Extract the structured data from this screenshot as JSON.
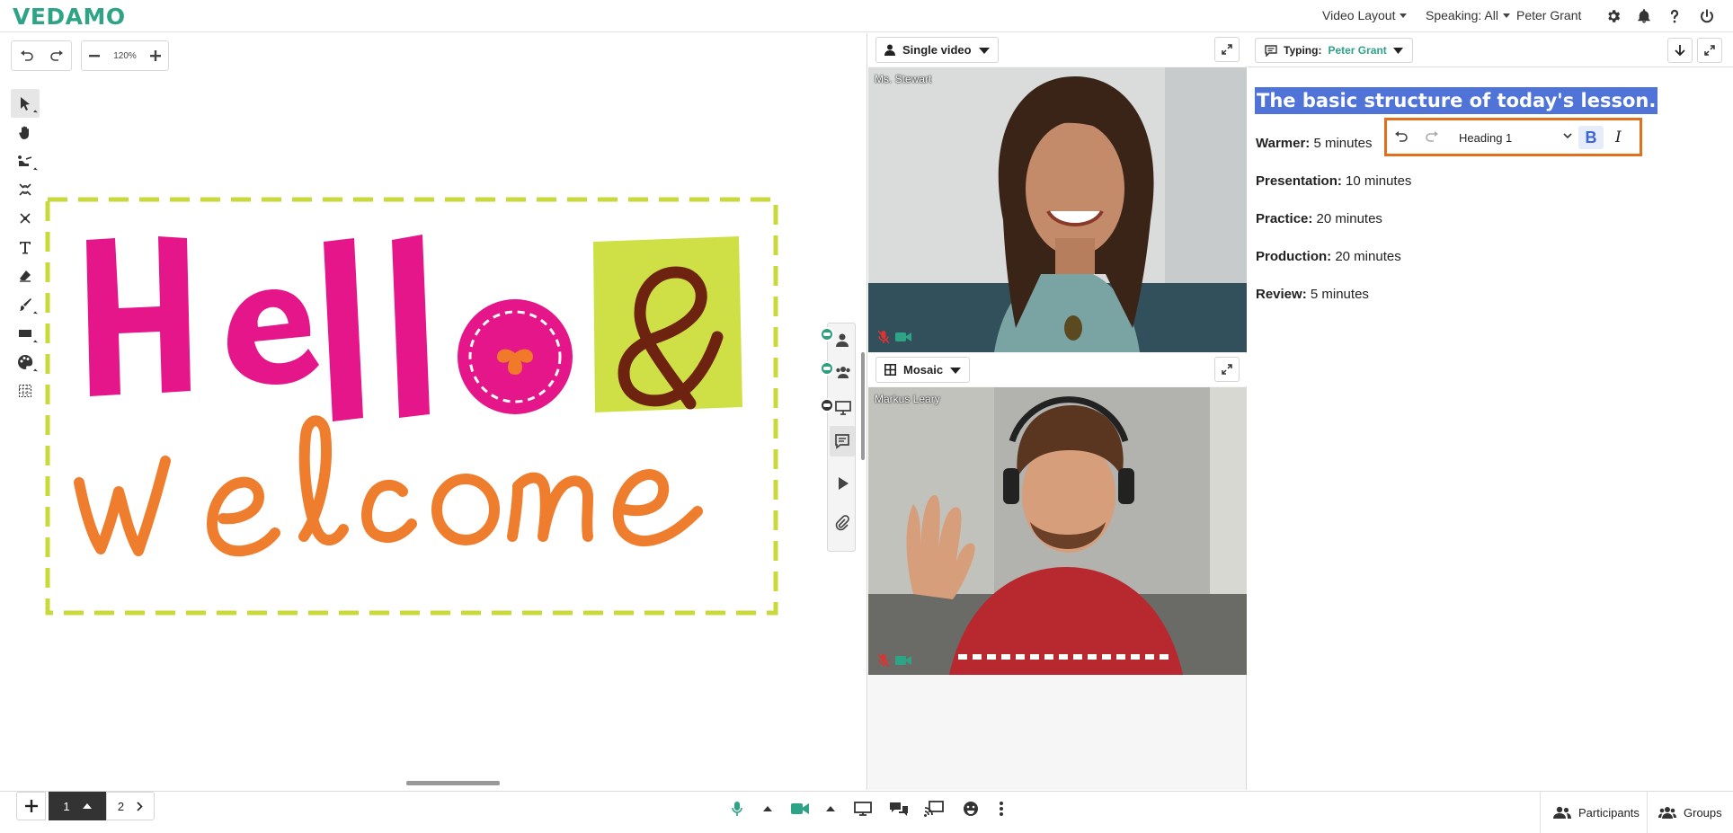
{
  "app": {
    "logo": "VEDAMO"
  },
  "topbar": {
    "video_layout": "Video Layout",
    "speaking": "Speaking: All",
    "user": "Peter Grant",
    "icons": [
      "gear-icon",
      "bell-icon",
      "help-icon",
      "power-icon"
    ]
  },
  "whiteboard": {
    "zoom": "120%",
    "tools": [
      "select",
      "hand",
      "pointer",
      "fit",
      "transform",
      "text",
      "eraser",
      "brush",
      "shape",
      "palette",
      "grid"
    ],
    "pages": {
      "current": "1",
      "next": "2"
    }
  },
  "video": {
    "top": {
      "mode": "Single video",
      "participant": "Ms. Stewart"
    },
    "bottom": {
      "mode": "Mosaic",
      "participant": "Markus Leary"
    }
  },
  "notes": {
    "typing_label": "Typing:",
    "typing_user": "Peter Grant",
    "heading": "The basic structure of today's lesson.",
    "format": {
      "style": "Heading 1",
      "bold": "B",
      "italic": "I"
    },
    "items": [
      {
        "label": "Warmer:",
        "value": "5 minutes"
      },
      {
        "label": "Presentation:",
        "value": "10 minutes"
      },
      {
        "label": "Practice:",
        "value": "20 minutes"
      },
      {
        "label": "Production:",
        "value": "20 minutes"
      },
      {
        "label": "Review:",
        "value": "5 minutes"
      }
    ]
  },
  "bottombar": {
    "participants": "Participants",
    "groups": "Groups"
  },
  "colors": {
    "brand": "#2fa386",
    "highlight": "#4f73d6",
    "focus": "#e0701e"
  }
}
